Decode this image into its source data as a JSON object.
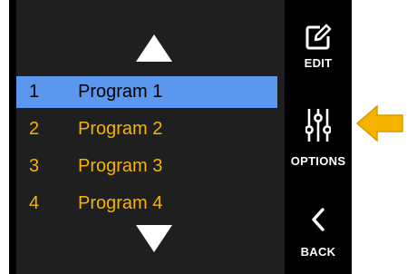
{
  "programs": [
    {
      "number": "1",
      "label": "Program 1",
      "selected": true
    },
    {
      "number": "2",
      "label": "Program 2",
      "selected": false
    },
    {
      "number": "3",
      "label": "Program 3",
      "selected": false
    },
    {
      "number": "4",
      "label": "Program 4",
      "selected": false
    }
  ],
  "sidebar": {
    "edit": {
      "label": "EDIT",
      "icon": "edit-icon"
    },
    "options": {
      "label": "OPTIONS",
      "icon": "sliders-icon"
    },
    "back": {
      "label": "BACK",
      "icon": "chevron-left-icon"
    }
  },
  "colors": {
    "screen": "#000000",
    "list_panel": "#1f1f1f",
    "selection": "#5b96ef",
    "item_text": "#f5b400",
    "pointer": "#f5b400"
  }
}
